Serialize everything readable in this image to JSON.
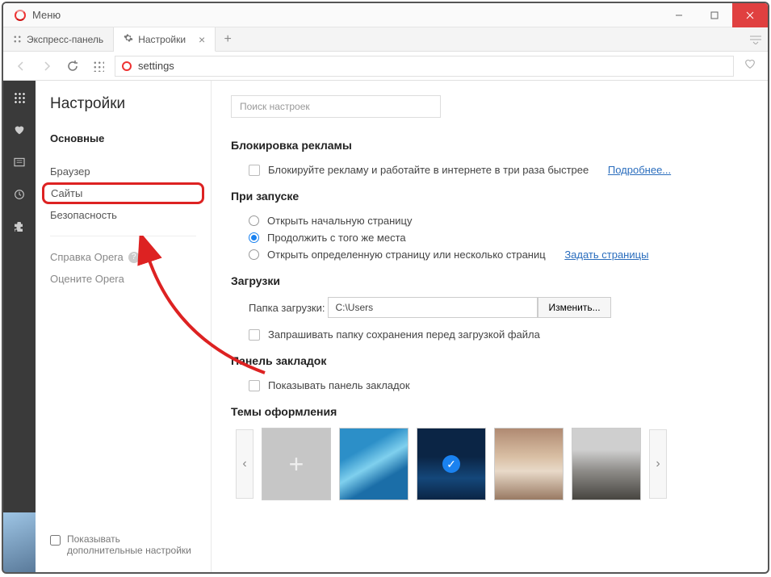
{
  "titlebar": {
    "menu_label": "Меню"
  },
  "tabs": {
    "items": [
      {
        "label": "Экспресс-панель"
      },
      {
        "label": "Настройки"
      }
    ],
    "add_label": "+"
  },
  "toolbar": {
    "address": "settings"
  },
  "sidebar": {
    "title": "Настройки",
    "current_section": "Основные",
    "nav": [
      {
        "label": "Браузер"
      },
      {
        "label": "Сайты"
      },
      {
        "label": "Безопасность"
      }
    ],
    "help_links": [
      {
        "label": "Справка Opera"
      },
      {
        "label": "Оцените Opera"
      }
    ],
    "advanced_toggle": "Показывать дополнительные настройки"
  },
  "content": {
    "search_placeholder": "Поиск настроек",
    "ads": {
      "heading": "Блокировка рекламы",
      "checkbox_label": "Блокируйте рекламу и работайте в интернете в три раза быстрее",
      "more_link": "Подробнее..."
    },
    "startup": {
      "heading": "При запуске",
      "options": [
        "Открыть начальную страницу",
        "Продолжить с того же места",
        "Открыть определенную страницу или несколько страниц"
      ],
      "set_pages_link": "Задать страницы"
    },
    "downloads": {
      "heading": "Загрузки",
      "folder_label": "Папка загрузки:",
      "folder_value": "C:\\Users",
      "change_btn": "Изменить...",
      "ask_label": "Запрашивать папку сохранения перед загрузкой файла"
    },
    "bookmarks": {
      "heading": "Панель закладок",
      "show_label": "Показывать панель закладок"
    },
    "themes": {
      "heading": "Темы оформления"
    }
  }
}
